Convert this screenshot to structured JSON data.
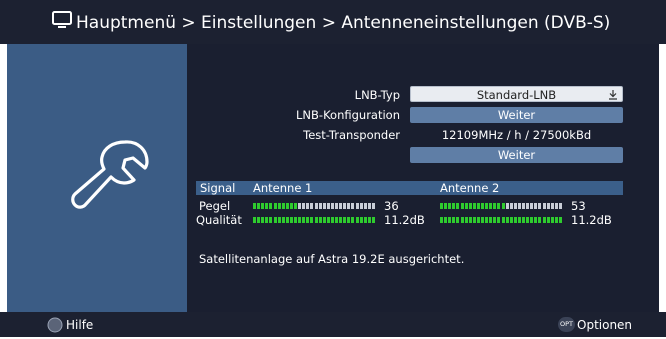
{
  "header": {
    "breadcrumb": "Hauptmenü > Einstellungen > Antenneneinstellungen (DVB-S)"
  },
  "settings": {
    "lnb_type_label": "LNB-Typ",
    "lnb_type_value": "Standard-LNB",
    "lnb_config_label": "LNB-Konfiguration",
    "lnb_config_button": "Weiter",
    "test_transponder_label": "Test-Transponder",
    "test_transponder_value": "12109MHz / h / 27500kBd",
    "test_transponder_button": "Weiter"
  },
  "signal": {
    "header_label": "Signal",
    "antennas": [
      {
        "name": "Antenne 1",
        "level_value": "36",
        "level_fraction": 0.36,
        "quality_value": "11.2dB",
        "quality_fraction": 1.0
      },
      {
        "name": "Antenne 2",
        "level_value": "53",
        "level_fraction": 0.53,
        "quality_value": "11.2dB",
        "quality_fraction": 1.0
      }
    ],
    "level_label": "Pegel",
    "quality_label": "Qualität"
  },
  "status_message": "Satellitenanlage auf Astra 19.2E ausgerichtet.",
  "footer": {
    "help_label": "Hilfe",
    "options_badge": "OPT",
    "options_label": "Optionen"
  },
  "colors": {
    "meter_on": "#2ecc2e",
    "meter_off": "#c9ced8",
    "panel_blue": "#3b5c85",
    "panel_dark": "#1a1f30",
    "header_bar": "#1c2131"
  }
}
